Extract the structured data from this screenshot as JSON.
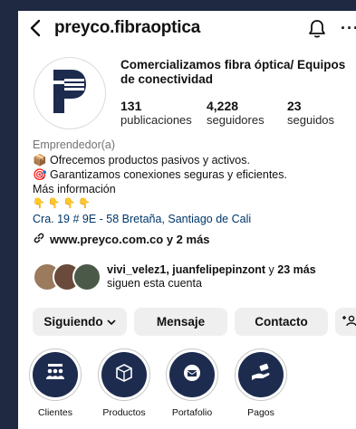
{
  "header": {
    "username": "preyco.fibraoptica",
    "back_icon": "chevron-left-icon",
    "bell_icon": "bell-icon",
    "more_icon": "more-horizontal-icon",
    "more_label": "···"
  },
  "profile": {
    "avatar_icon": "preyco-logo-icon",
    "name": "Comercializamos fibra óptica/ Equipos de conectividad",
    "stats": [
      {
        "value": "131",
        "label": "publicaciones"
      },
      {
        "value": "4,228",
        "label": "seguidores"
      },
      {
        "value": "23",
        "label": "seguidos"
      }
    ]
  },
  "bio": {
    "category": "Emprendedor(a)",
    "line1": "📦 Ofrecemos productos pasivos y activos.",
    "line2": "🎯 Garantizamos conexiones seguras y eficientes.",
    "more_info": "Más información",
    "emojis": "👇 👇 👇 👇",
    "address": "Cra. 19 # 9E - 58 Bretaña, Santiago de Cali",
    "link": "www.preyco.com.co y 2 más",
    "link_icon": "link-icon"
  },
  "followed_by": {
    "names": "vivi_velez1, juanfelipepinzont",
    "connector": " y ",
    "more": "23 más",
    "suffix": "siguen esta cuenta"
  },
  "actions": {
    "following": "Siguiendo",
    "message": "Mensaje",
    "contact": "Contacto",
    "add_user_icon": "add-user-icon"
  },
  "highlights": [
    {
      "label": "Clientes",
      "icon": "team-icon"
    },
    {
      "label": "Productos",
      "icon": "box-icon"
    },
    {
      "label": "Portafolio",
      "icon": "portfolio-icon"
    },
    {
      "label": "Pagos",
      "icon": "payment-hand-icon"
    }
  ],
  "colors": {
    "background": "#1f2942",
    "highlight_fill": "#1c2b4e",
    "button_bg": "#efefef",
    "link_blue": "#00376b"
  }
}
